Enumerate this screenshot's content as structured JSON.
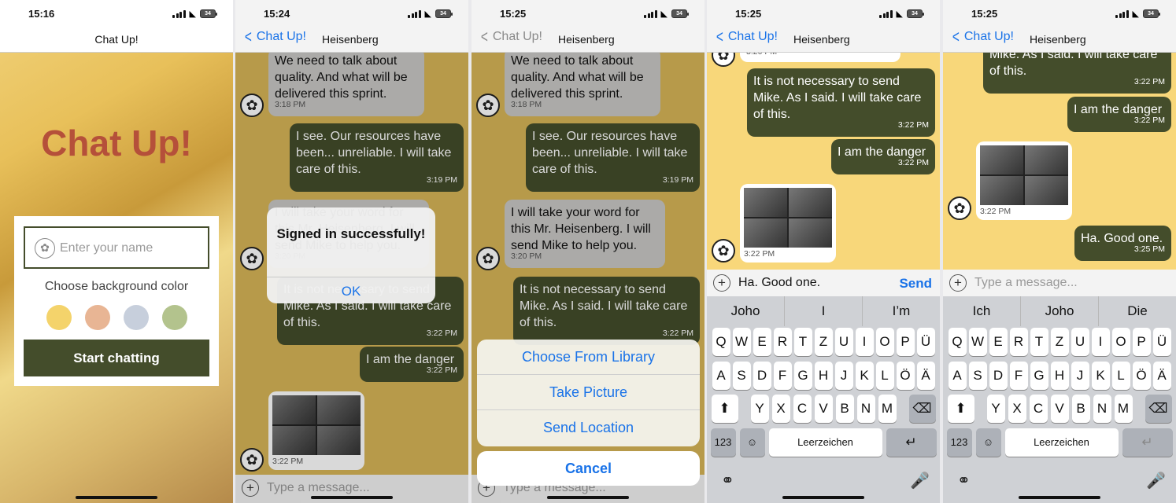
{
  "screens": {
    "welcome": {
      "time": "15:16",
      "battery": "34",
      "nav_title": "Chat Up!",
      "app_title": "Chat Up!",
      "name_placeholder": "Enter your name",
      "bg_label": "Choose background color",
      "colors": [
        "#f4d36b",
        "#e8b594",
        "#c7cfdc",
        "#b3c38d"
      ],
      "start_button": "Start chatting"
    },
    "chat1": {
      "time": "15:24",
      "battery": "34",
      "back": "Chat Up!",
      "title": "Heisenberg",
      "msgs": [
        {
          "text": "We need to talk about quality. And what will be delivered this sprint.",
          "time": "3:18 PM"
        },
        {
          "text": "I see. Our resources have been... unreliable. I will take care of this.",
          "time": "3:19 PM"
        },
        {
          "text": "I will take your word for this Mr. Heisenberg. I will send Mike to help you.",
          "time": "3:20 PM"
        },
        {
          "text": "It is not necessary to send Mike. As I said. I will take care of this.",
          "time": "3:22 PM"
        },
        {
          "text": "I am the danger",
          "time": "3:22 PM"
        },
        {
          "text": "",
          "time": "3:22 PM"
        }
      ],
      "alert_title": "Signed in successfully!",
      "alert_ok": "OK",
      "input_placeholder": "Type a message..."
    },
    "chat2": {
      "time": "15:25",
      "battery": "34",
      "back": "Chat Up!",
      "title": "Heisenberg",
      "options": [
        "Choose From Library",
        "Take Picture",
        "Send Location"
      ],
      "cancel": "Cancel",
      "input_placeholder": "Type a message..."
    },
    "chat3": {
      "time": "15:25",
      "battery": "34",
      "back": "Chat Up!",
      "title": "Heisenberg",
      "input_value": "Ha. Good one.",
      "send": "Send",
      "suggestions": [
        "Joho",
        "I",
        "I’m"
      ]
    },
    "chat4": {
      "time": "15:25",
      "battery": "34",
      "back": "Chat Up!",
      "title": "Heisenberg",
      "msgs": [
        {
          "text": "Mike. As I said. I will take care of this.",
          "time": "3:22 PM"
        },
        {
          "text": "I am the danger",
          "time": "3:22 PM"
        },
        {
          "text": "",
          "time": "3:22 PM"
        },
        {
          "text": "Ha. Good one.",
          "time": "3:25 PM"
        }
      ],
      "input_placeholder": "Type a message...",
      "suggestions": [
        "Ich",
        "Joho",
        "Die"
      ]
    }
  },
  "keyboard": {
    "row1": [
      "Q",
      "W",
      "E",
      "R",
      "T",
      "Z",
      "U",
      "I",
      "O",
      "P",
      "Ü"
    ],
    "row2": [
      "A",
      "S",
      "D",
      "F",
      "G",
      "H",
      "J",
      "K",
      "L",
      "Ö",
      "Ä"
    ],
    "row3": [
      "Y",
      "X",
      "C",
      "V",
      "B",
      "N",
      "M"
    ],
    "num": "123",
    "space": "Leerzeichen"
  }
}
